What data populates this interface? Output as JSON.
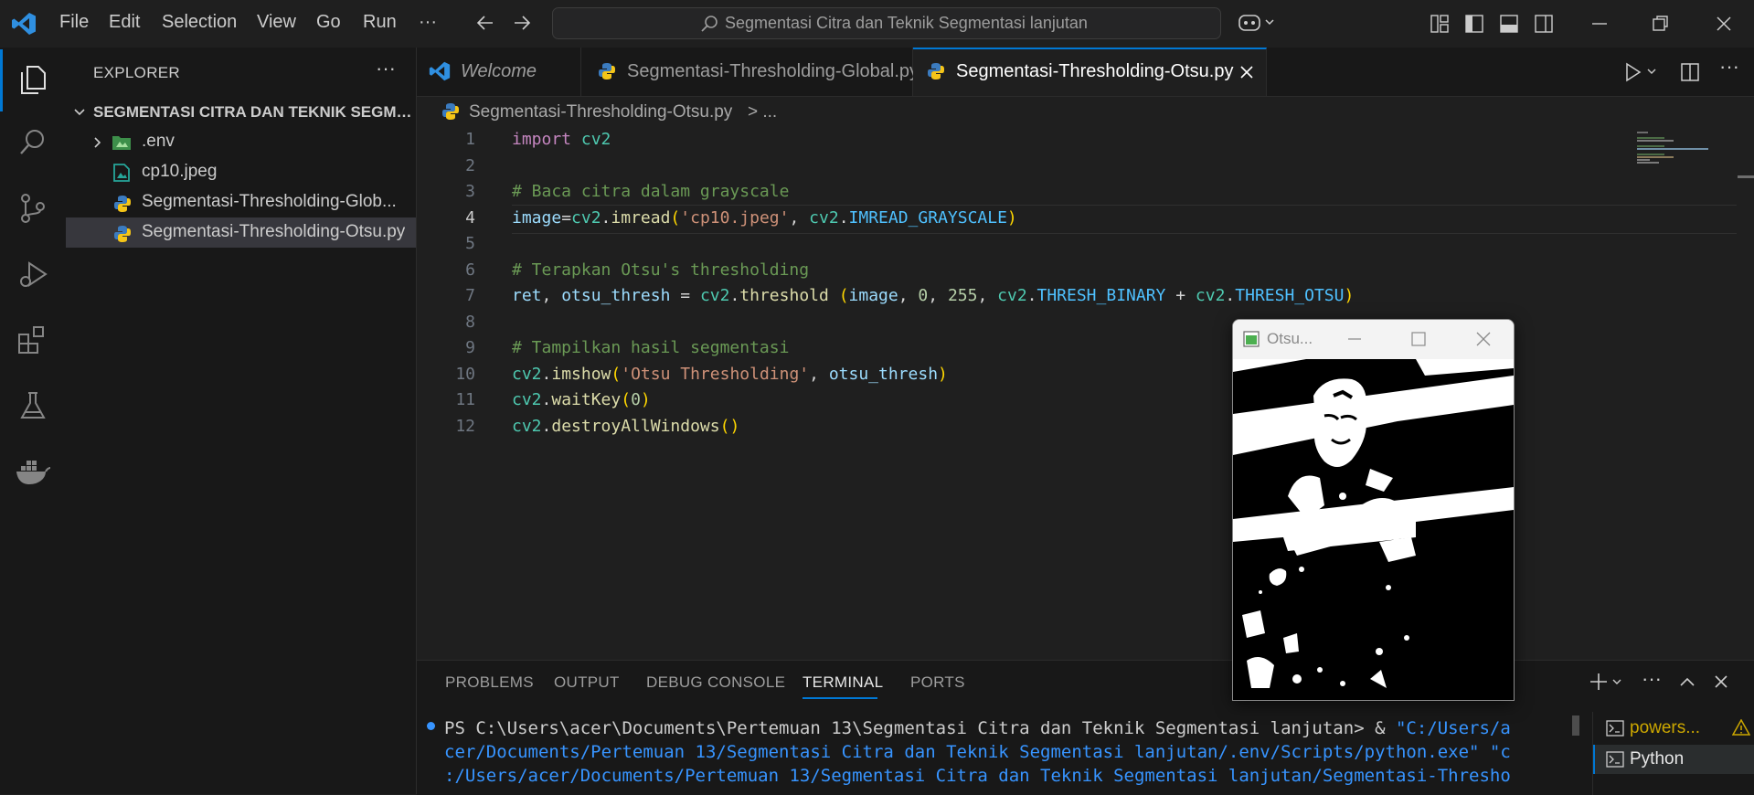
{
  "menu": [
    "File",
    "Edit",
    "Selection",
    "View",
    "Go",
    "Run",
    "···"
  ],
  "search": {
    "text": "Segmentasi Citra dan Teknik Segmentasi lanjutan"
  },
  "explorer": {
    "title": "EXPLORER",
    "folder": "SEGMENTASI CITRA DAN TEKNIK SEGME...",
    "items": [
      ".env",
      "cp10.jpeg",
      "Segmentasi-Thresholding-Glob...",
      "Segmentasi-Thresholding-Otsu.py"
    ]
  },
  "tabs": [
    "Welcome",
    "Segmentasi-Thresholding-Global.py",
    "Segmentasi-Thresholding-Otsu.py"
  ],
  "breadcrumb": {
    "file": "Segmentasi-Thresholding-Otsu.py",
    "sep": "> ..."
  },
  "code": {
    "line_numbers": [
      "1",
      "2",
      "3",
      "4",
      "5",
      "6",
      "7",
      "8",
      "9",
      "10",
      "11",
      "12"
    ],
    "current_line": 4
  },
  "panel": {
    "tabs": [
      "PROBLEMS",
      "OUTPUT",
      "DEBUG CONSOLE",
      "TERMINAL",
      "PORTS"
    ],
    "terminal_lines": [
      "PS C:\\Users\\acer\\Documents\\Pertemuan 13\\Segmentasi Citra dan Teknik Segmentasi lanjutan> & ",
      "\"C:/Users/a",
      "cer/Documents/Pertemuan 13/Segmentasi Citra dan Teknik Segmentasi lanjutan/.env/Scripts/python.exe\" \"c",
      ":/Users/acer/Documents/Pertemuan 13/Segmentasi Citra dan Teknik Segmentasi lanjutan/Segmentasi-Thresho"
    ],
    "terminals": [
      "powers...",
      "Python"
    ]
  },
  "otsu_window": {
    "title": "Otsu..."
  },
  "colors": {
    "accent": "#0078d4",
    "editor_bg": "#1f1f1f",
    "sidebar_bg": "#181818"
  }
}
